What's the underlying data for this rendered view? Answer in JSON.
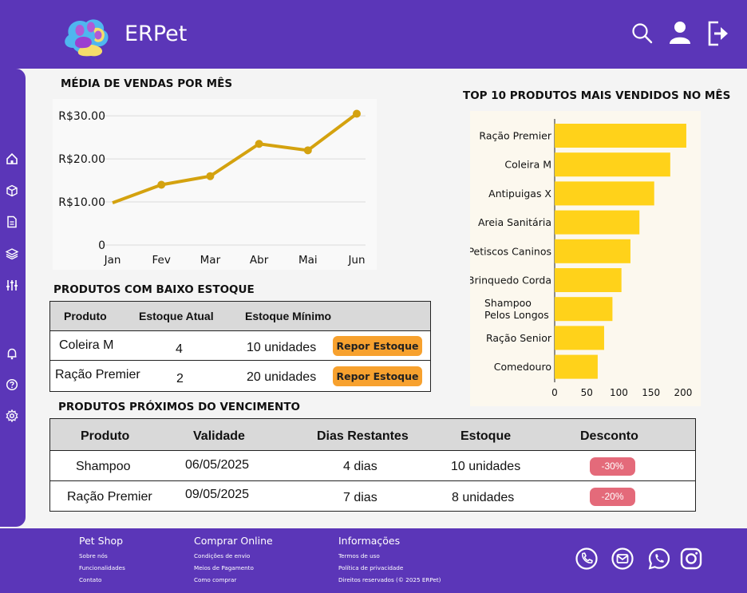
{
  "app": {
    "title": "ERPet"
  },
  "colors": {
    "primary": "#5b36b8",
    "line": "#d4a20f",
    "bar": "#ffd21a",
    "button": "#f7a12e",
    "discount": "#e46a7a"
  },
  "header": {
    "icons": [
      "search-icon",
      "user-icon",
      "logout-icon"
    ]
  },
  "sidebar": {
    "icons": [
      "home-icon",
      "box-icon",
      "document-icon",
      "layers-icon",
      "sliders-icon",
      "bell-icon",
      "help-icon",
      "settings-icon"
    ]
  },
  "sales_chart": {
    "title": "MÉDIA DE VENDAS POR MÊS"
  },
  "top_products": {
    "title": "TOP 10 PRODUTOS MAIS VENDIDOS NO MÊS"
  },
  "chart_data": [
    {
      "type": "line",
      "title": "MÉDIA DE VENDAS POR MÊS",
      "categories": [
        "Jan",
        "Fev",
        "Mar",
        "Abr",
        "Mai",
        "Jun"
      ],
      "values": [
        9.8,
        14,
        16,
        23.5,
        22,
        30.5
      ],
      "ylim": [
        0,
        33
      ],
      "yticks": [
        0,
        10,
        20,
        30
      ],
      "ytick_labels": [
        "0",
        "R$10.00",
        "R$20.00",
        "R$30.00"
      ],
      "grid": true
    },
    {
      "type": "bar",
      "orientation": "horizontal",
      "title": "TOP 10 PRODUTOS MAIS VENDIDOS NO MÊS",
      "categories": [
        "Ração Premier",
        "Coleira M",
        "Antipuigas X",
        "Areia Sanitária",
        "Petiscos Caninos",
        "Brinquedo Corda",
        "Shampoo Pelos Longos",
        "Ração Senior",
        "Comedouro"
      ],
      "category_lines": [
        [
          "Ração Premier"
        ],
        [
          "Coleira M"
        ],
        [
          "Antipuigas X"
        ],
        [
          "Areia Sanitária"
        ],
        [
          "Petiscos Caninos"
        ],
        [
          "Brinquedo Corda"
        ],
        [
          "Shampoo",
          "Pelos Longos"
        ],
        [
          "Ração Senior"
        ],
        [
          "Comedouro"
        ]
      ],
      "values": [
        205,
        180,
        155,
        132,
        118,
        104,
        90,
        77,
        67
      ],
      "xlim": [
        0,
        215
      ],
      "xticks": [
        0,
        50,
        100,
        150,
        200
      ]
    }
  ],
  "low_stock": {
    "title": "PRODUTOS COM BAIXO ESTOQUE",
    "headers": [
      "Produto",
      "Estoque Atual",
      "Estoque Mínimo"
    ],
    "rows": [
      {
        "produto": "Coleira M",
        "atual": "4",
        "minimo": "10 unidades",
        "action": "Repor Estoque"
      },
      {
        "produto": "Ração Premier",
        "atual": "2",
        "minimo": "20 unidades",
        "action": "Repor Estoque"
      }
    ]
  },
  "expiring": {
    "title": "PRODUTOS PRÓXIMOS DO VENCIMENTO",
    "headers": [
      "Produto",
      "Validade",
      "Dias Restantes",
      "Estoque",
      "Desconto"
    ],
    "rows": [
      {
        "produto": "Shampoo",
        "validade": "06/05/2025",
        "dias": "4 dias",
        "estoque": "10 unidades",
        "desconto": "-30%"
      },
      {
        "produto": "Ração Premier",
        "validade": "09/05/2025",
        "dias": "7 dias",
        "estoque": "8 unidades",
        "desconto": "-20%"
      }
    ]
  },
  "footer": {
    "columns": [
      {
        "title": "Pet Shop",
        "links": [
          "Sobre nós",
          "Funcionalidades",
          "Contato"
        ]
      },
      {
        "title": "Comprar Online",
        "links": [
          "Condições de envio",
          "Meios de Pagamento",
          "Como comprar"
        ]
      },
      {
        "title": "Informações",
        "links": [
          "Termos de uso",
          "Política de privacidade",
          "Direitos reservados (© 2025 ERPet)"
        ]
      }
    ],
    "social": [
      "phone-icon",
      "mail-icon",
      "whatsapp-icon",
      "instagram-icon"
    ]
  }
}
